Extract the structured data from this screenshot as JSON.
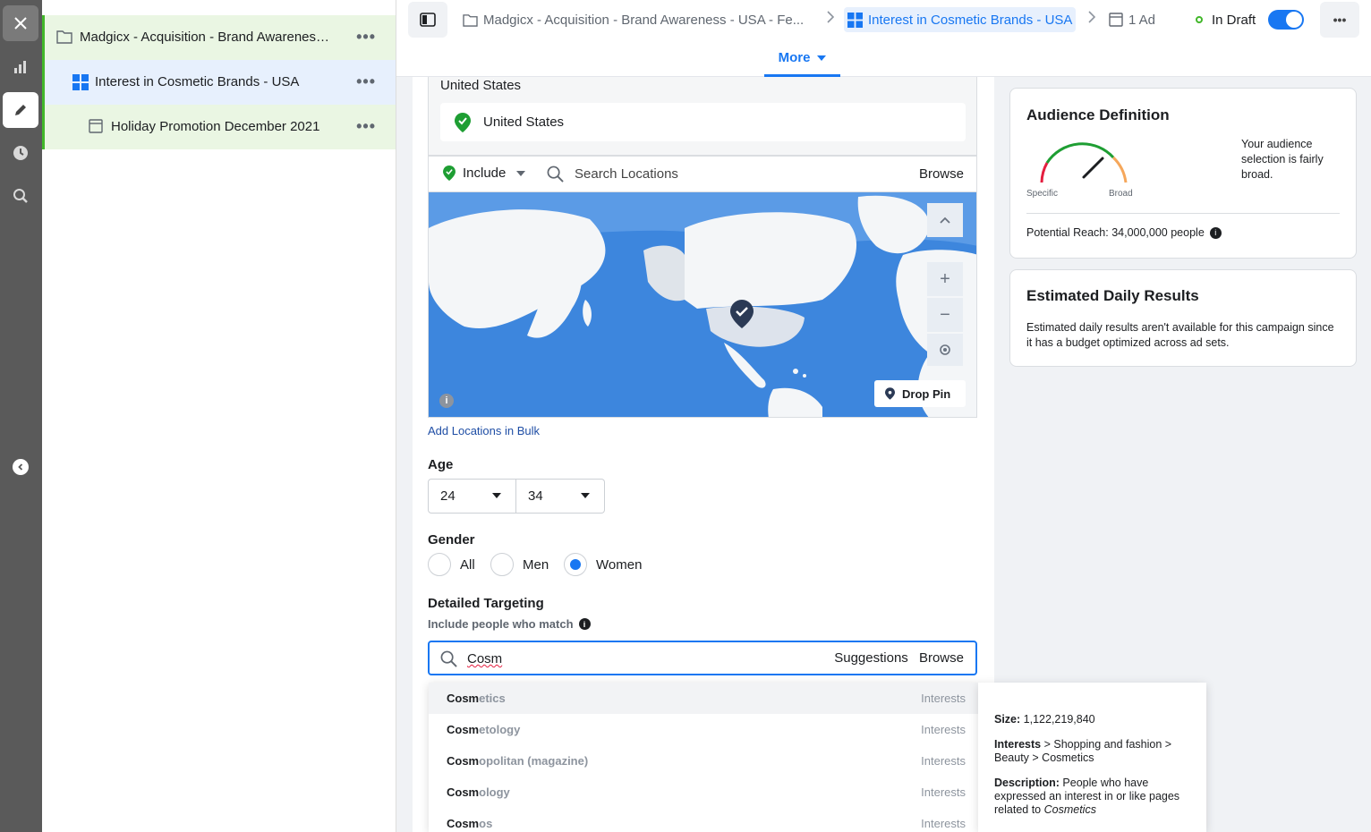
{
  "tree": {
    "campaign": "Madgicx - Acquisition - Brand Awareness - USA - Female",
    "adset": "Interest in Cosmetic Brands - USA",
    "ad": "Holiday Promotion December 2021"
  },
  "header": {
    "crumb_campaign": "Madgicx - Acquisition - Brand Awareness - USA - Fe...",
    "crumb_adset": "Interest in Cosmetic Brands - USA",
    "crumb_ad": "1 Ad",
    "status": "In Draft",
    "more_tab": "More"
  },
  "locations": {
    "title": "United States",
    "selected": "United States",
    "include": "Include",
    "search_placeholder": "Search Locations",
    "browse": "Browse",
    "drop_pin": "Drop Pin",
    "add_bulk": "Add Locations in Bulk"
  },
  "age": {
    "label": "Age",
    "min": "24",
    "max": "34"
  },
  "gender": {
    "label": "Gender",
    "options": [
      "All",
      "Men",
      "Women"
    ],
    "selected": "Women"
  },
  "detailed_targeting": {
    "label": "Detailed Targeting",
    "sublabel": "Include people who match",
    "query": "Cosm",
    "suggestions": "Suggestions",
    "browse": "Browse",
    "results": [
      {
        "match": "Cosm",
        "rest": "etics",
        "category": "Interests"
      },
      {
        "match": "Cosm",
        "rest": "etology",
        "category": "Interests"
      },
      {
        "match": "Cosm",
        "rest": "opolitan (magazine)",
        "category": "Interests"
      },
      {
        "match": "Cosm",
        "rest": "ology",
        "category": "Interests"
      },
      {
        "match": "Cosm",
        "rest": "os",
        "category": "Interests"
      }
    ]
  },
  "tooltip": {
    "size_label": "Size:",
    "size_value": "1,122,219,840",
    "path_label": "Interests",
    "path_rest": "> Shopping and fashion > Beauty > Cosmetics",
    "desc_label": "Description:",
    "desc_text": "People who have expressed an interest in or like pages related to",
    "desc_italic": "Cosmetics"
  },
  "audience": {
    "title": "Audience Definition",
    "specific": "Specific",
    "broad": "Broad",
    "summary": "Your audience selection is fairly broad.",
    "reach": "Potential Reach: 34,000,000 people"
  },
  "estimated": {
    "title": "Estimated Daily Results",
    "text": "Estimated daily results aren't available for this campaign since it has a budget optimized across ad sets."
  }
}
